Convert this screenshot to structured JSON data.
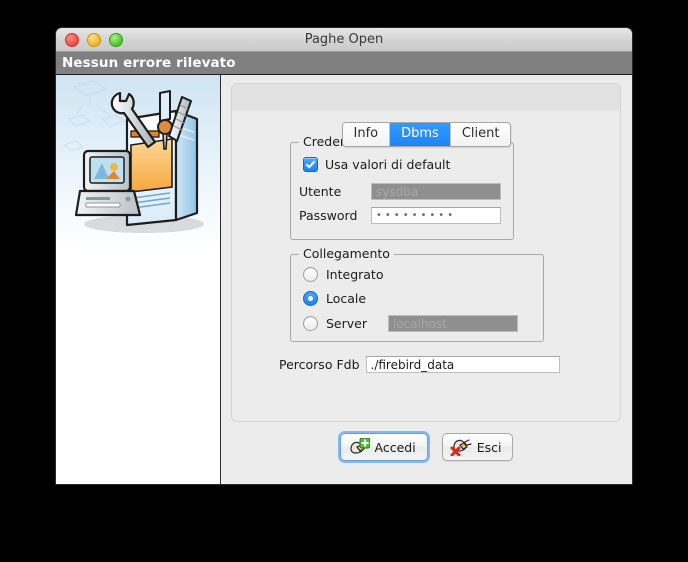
{
  "window": {
    "title": "Paghe Open",
    "status_message": "Nessun errore rilevato",
    "controls": {
      "close": "close-button",
      "minimize": "minimize-button",
      "zoom": "zoom-button"
    }
  },
  "tabs": [
    {
      "label": "Info",
      "active": false
    },
    {
      "label": "Dbms",
      "active": true
    },
    {
      "label": "Client",
      "active": false
    }
  ],
  "illustration": {
    "name": "software-toolbox-illustration",
    "description": "Desktop computer with a software box containing a wrench, screwdriver and file"
  },
  "credenziali": {
    "title": "Credenziali",
    "use_defaults": {
      "label": "Usa valori di default",
      "checked": true
    },
    "utente": {
      "label": "Utente",
      "value": "sysdba",
      "disabled": true
    },
    "password": {
      "label": "Password",
      "value": "•••••••••",
      "masked": true
    }
  },
  "collegamento": {
    "title": "Collegamento",
    "options": [
      {
        "label": "Integrato",
        "selected": false
      },
      {
        "label": "Locale",
        "selected": true
      },
      {
        "label": "Server",
        "selected": false
      }
    ],
    "server_host": {
      "value": "localhost",
      "disabled": true
    }
  },
  "percorso": {
    "label": "Percorso Fdb",
    "value": "./firebird_data"
  },
  "buttons": {
    "accedi": {
      "label": "Accedi",
      "icon": "plug-connect-icon",
      "focused": true
    },
    "esci": {
      "label": "Esci",
      "icon": "plug-disconnect-icon",
      "focused": false
    }
  },
  "colors": {
    "accent_blue": "#1a82f5",
    "tab_active": "#2f97fb",
    "status_bar": "#808080",
    "window_bg": "#ececec",
    "desktop": "#000000",
    "disabled_field": "#8f8f8f"
  }
}
